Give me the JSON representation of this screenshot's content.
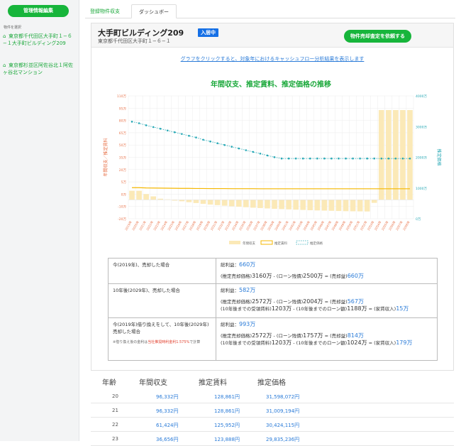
{
  "sidebar": {
    "manage_button": "管理情報編集",
    "select_label": "物件を選択",
    "properties": [
      "東京都千代田区大手町１−６−１大手町ビルディング209",
      "東京都杉並区阿佐谷北１阿佐ヶ谷北マンション"
    ]
  },
  "tabs": [
    "登録物件収支",
    "ダッシュボード"
  ],
  "header": {
    "building_name": "大手町ビルディング209",
    "status_badge": "入居中",
    "address": "東京都千代田区大手町１−６−１",
    "assess_button": "物件売却査定を依頼する"
  },
  "hint_link": "グラフをクリックすると、対象年におけるキャッシュフロー分析結果を表示します",
  "chart_data": {
    "type": "bar",
    "title": "年間収支、推定賃料、推定価格の推移",
    "ylabel": "年間収支／推定賃料",
    "y2label": "推定価格",
    "ylim": [
      -20,
      110
    ],
    "yticks": [
      "110万",
      "95万",
      "80万",
      "65万",
      "50万",
      "35万",
      "20万",
      "5万",
      "0万",
      "-10万",
      "-20万"
    ],
    "y2lim": [
      0,
      4000
    ],
    "y2ticks": [
      "4000万",
      "3000万",
      "2000万",
      "1000万",
      "0万"
    ],
    "categories": [
      "2019年",
      "2020年",
      "2021年",
      "2022年",
      "2023年",
      "2024年",
      "2025年",
      "2026年",
      "2027年",
      "2028年",
      "2029年",
      "2030年",
      "2031年",
      "2032年",
      "2033年",
      "2034年",
      "2035年",
      "2036年",
      "2037年",
      "2038年",
      "2039年",
      "2040年",
      "2041年",
      "2042年",
      "2043年",
      "2044年",
      "2045年",
      "2046年",
      "2047年",
      "2048年",
      "2049年",
      "2050年",
      "2051年",
      "2052年",
      "2053年",
      "2054年",
      "2055年",
      "2056年",
      "2057年",
      "2058年"
    ],
    "series": [
      {
        "name": "年間収支",
        "kind": "bar",
        "color": "#fbe9b7",
        "values": [
          9.6,
          9.6,
          6.1,
          3.7,
          1.2,
          0.5,
          -0.8,
          -1.5,
          -2.5,
          -3.4,
          -4.2,
          -5,
          -5.6,
          -6.2,
          -6.8,
          -7.3,
          -7.8,
          -8.3,
          -8.7,
          -9.1,
          -9.5,
          -9.8,
          -10.1,
          -10.4,
          -10.7,
          -11,
          -11.2,
          -11.4,
          -11.6,
          -11.8,
          -12,
          -12.1,
          -12.2,
          -12.3,
          -3.2,
          95,
          95,
          95,
          95,
          95
        ]
      },
      {
        "name": "推定賃料",
        "kind": "line",
        "color": "#f5b700",
        "values": [
          12.9,
          12.9,
          12.6,
          12.5,
          12.4,
          12.3,
          12.2,
          12.1,
          12.1,
          12.0,
          12.0,
          11.9,
          11.9,
          11.9,
          11.8,
          11.8,
          11.8,
          11.8,
          11.7,
          11.7,
          11.7,
          11.7,
          11.7,
          11.7,
          11.7,
          11.7,
          11.7,
          11.7,
          11.7,
          11.7,
          11.7,
          11.7,
          11.7,
          11.7,
          11.7,
          11.7,
          11.7,
          11.7,
          11.7,
          11.7
        ]
      },
      {
        "name": "推定価格",
        "kind": "dotted",
        "axis": "right",
        "color": "#27a8b5",
        "values": [
          3160,
          3110,
          3042,
          2985,
          2930,
          2873,
          2816,
          2760,
          2700,
          2645,
          2572,
          2515,
          2458,
          2400,
          2345,
          2288,
          2230,
          2175,
          2120,
          2060,
          2004,
          1960,
          1960,
          1960,
          1960,
          1960,
          1960,
          1960,
          1960,
          1960,
          1960,
          1960,
          1960,
          1960,
          1960,
          1960,
          1960,
          1960,
          1960,
          1960
        ]
      }
    ],
    "legend": [
      "年間収支",
      "推定賃料",
      "推定価格"
    ],
    "legend_position": "bottom",
    "grid": true
  },
  "summary": [
    {
      "label": "今(2019年)、売却した場合",
      "total_label": "総利益：",
      "total": "660万",
      "lines": [
        [
          "(推定売却価格)",
          "3160万",
          " - (ローン残債)",
          "2500万",
          " = (売却益)",
          "660万"
        ]
      ]
    },
    {
      "label": "10年後(2029年)、売却した場合",
      "total_label": "総利益：",
      "total": "582万",
      "lines": [
        [
          "(推定売却価格)",
          "2572万",
          " - (ローン残債)",
          "2004万",
          " = (売却益)",
          "567万"
        ],
        [
          "(10年後までの受領賃料)",
          "1203万",
          " - (10年後までのローン額)",
          "1188万",
          " = (家賃収入)",
          "15万"
        ]
      ]
    },
    {
      "label": "今(2019年)借り換えをして、10年後(2029年)売却した場合",
      "note_prefix": "※借り換え後の金利は",
      "note_red": "当社推奨時利金利1.575%",
      "note_suffix": "で計算",
      "total_label": "総利益：",
      "total": "993万",
      "lines": [
        [
          "(推定売却価格)",
          "2572万",
          " - (ローン残債)",
          "1757万",
          " = (売却益)",
          "814万"
        ],
        [
          "(10年後までの受領賃料)",
          "1203万",
          " - (10年後までのローン額)",
          "1024万",
          " = (家賃収入)",
          "179万"
        ]
      ]
    }
  ],
  "table": {
    "headers": [
      "年齢",
      "年間収支",
      "推定賃料",
      "推定価格"
    ],
    "rows": [
      [
        "20",
        "96,332円",
        "128,861円",
        "31,598,072円"
      ],
      [
        "21",
        "96,332円",
        "128,861円",
        "31,009,194円"
      ],
      [
        "22",
        "61,424円",
        "125,952円",
        "30,424,115円"
      ],
      [
        "23",
        "36,656円",
        "123,888円",
        "29,835,236円"
      ]
    ]
  }
}
